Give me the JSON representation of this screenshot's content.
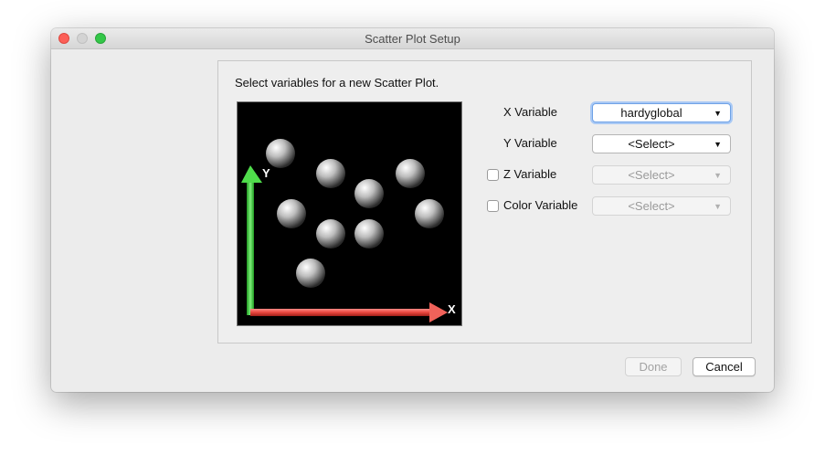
{
  "window": {
    "title": "Scatter Plot Setup"
  },
  "panel": {
    "instruction": "Select variables for a new Scatter Plot."
  },
  "preview": {
    "x_axis_label": "X",
    "y_axis_label": "Y",
    "colors": {
      "x_axis": "#e8463e",
      "y_axis": "#39c83a",
      "sphere": "#cfcfcf",
      "background": "#000000"
    }
  },
  "variables": {
    "x": {
      "label": "X Variable",
      "value": "hardyglobal",
      "enabled": true,
      "focused": true
    },
    "y": {
      "label": "Y Variable",
      "value": "<Select>",
      "enabled": true
    },
    "z": {
      "label": "Z Variable",
      "value": "<Select>",
      "enabled": false,
      "checked": false
    },
    "color": {
      "label": "Color Variable",
      "value": "<Select>",
      "enabled": false,
      "checked": false
    }
  },
  "buttons": {
    "done": "Done",
    "cancel": "Cancel"
  },
  "icons": {
    "dropdown": "chevron-down-icon"
  }
}
